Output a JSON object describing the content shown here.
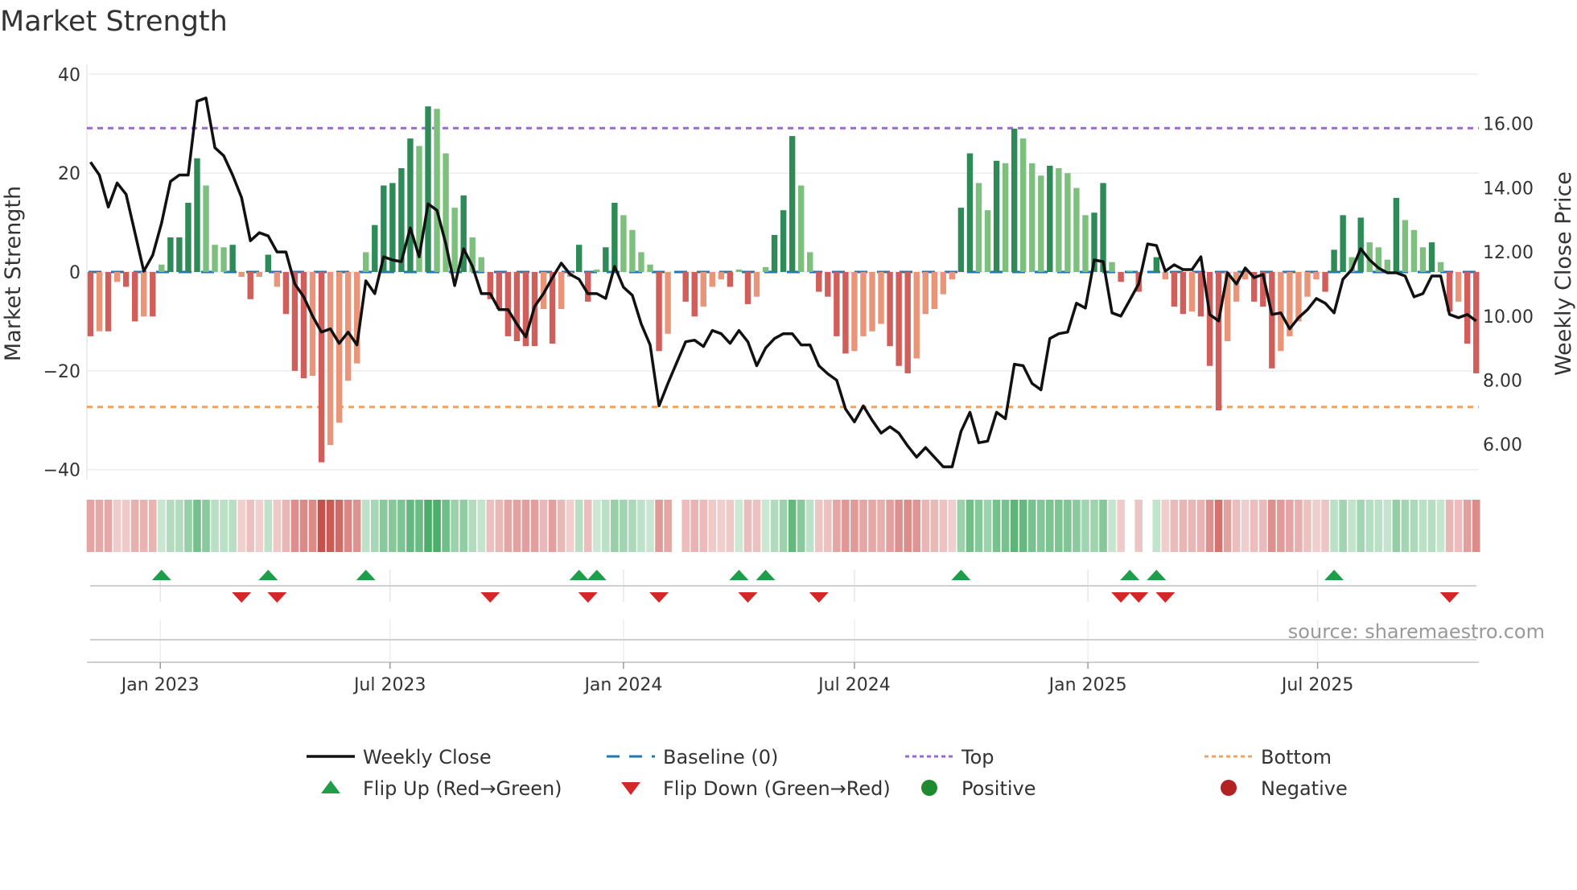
{
  "title": "Market Strength",
  "source": "source: sharemaestro.com",
  "colors": {
    "bar_pos_dark": "#2e8b57",
    "bar_pos_light": "#7dbf7d",
    "bar_neg_dark": "#d05e5b",
    "bar_neg_light": "#e8957a",
    "close": "#111111",
    "baseline": "#1f77b4",
    "top": "#9b66d6",
    "bottom": "#f0a35e",
    "flip_up": "#1f9e4a",
    "flip_down": "#d62728",
    "positive": "#1e8a2e",
    "negative": "#b22222"
  },
  "legend": [
    {
      "label": "Weekly Close",
      "kind": "line",
      "color": "#111111"
    },
    {
      "label": "Baseline (0)",
      "kind": "dash",
      "color": "#1f77b4"
    },
    {
      "label": "Top",
      "kind": "dot",
      "color": "#9b66d6"
    },
    {
      "label": "Bottom",
      "kind": "dot",
      "color": "#f0a35e"
    },
    {
      "label": "Flip Up (Red→Green)",
      "kind": "up",
      "color": "#1f9e4a"
    },
    {
      "label": "Flip Down (Green→Red)",
      "kind": "down",
      "color": "#d62728"
    },
    {
      "label": "Positive",
      "kind": "circle",
      "color": "#1e8a2e"
    },
    {
      "label": "Negative",
      "kind": "circle",
      "color": "#b22222"
    }
  ],
  "chart_data": {
    "type": "bar",
    "title": "Market Strength",
    "ylabel": "Market Strength",
    "y2label": "Weekly Close Price",
    "ylim": [
      -42,
      42
    ],
    "y2lim": [
      4.9,
      17.85
    ],
    "yticks": [
      {
        "v": 40,
        "label": "40"
      },
      {
        "v": 20,
        "label": "20"
      },
      {
        "v": 0,
        "label": "0"
      },
      {
        "v": -20,
        "label": "−20"
      },
      {
        "v": -40,
        "label": "−40"
      }
    ],
    "y2ticks": [
      {
        "v": 16,
        "label": "16.00"
      },
      {
        "v": 14,
        "label": "14.00"
      },
      {
        "v": 12,
        "label": "12.00"
      },
      {
        "v": 10,
        "label": "10.00"
      },
      {
        "v": 8,
        "label": "8.00"
      },
      {
        "v": 6,
        "label": "6.00"
      }
    ],
    "xticks": [
      {
        "date": "2023-01-01",
        "label": "Jan 2023"
      },
      {
        "date": "2023-07-01",
        "label": "Jul 2023"
      },
      {
        "date": "2024-01-01",
        "label": "Jan 2024"
      },
      {
        "date": "2024-07-01",
        "label": "Jul 2024"
      },
      {
        "date": "2025-01-01",
        "label": "Jan 2025"
      },
      {
        "date": "2025-07-01",
        "label": "Jul 2025"
      }
    ],
    "x_start": "2022-11-07",
    "x_step_days": 7,
    "top_level": 29.1,
    "bottom_level": -27.3,
    "strength": [
      -13,
      -12,
      -12,
      -2,
      -3,
      -10,
      -9,
      -9,
      1.5,
      7,
      7,
      14,
      23,
      17.5,
      5.5,
      5,
      5.5,
      -1,
      -5.5,
      -1,
      3.5,
      -3,
      -8.5,
      -20,
      -21.5,
      -21,
      -38.5,
      -35,
      -30.5,
      -22,
      -18.5,
      4,
      9.5,
      17.5,
      18,
      21,
      27,
      25.5,
      33.5,
      33,
      24,
      13,
      15.5,
      7,
      3,
      -5.5,
      -7.5,
      -13,
      -14,
      -15,
      -15,
      -7.5,
      -14.5,
      -7.5,
      -1,
      5.5,
      -6,
      0.5,
      5,
      14,
      11.5,
      8.5,
      4,
      1.5,
      -16,
      -12.5,
      0,
      -6,
      -9,
      -7,
      -3,
      -1.5,
      -3,
      0.5,
      -6.5,
      -5,
      1,
      7.5,
      12.5,
      27.5,
      17.5,
      4,
      -4,
      -5,
      -13,
      -16.5,
      -16,
      -13,
      -12,
      -10.5,
      -15,
      -19,
      -20.5,
      -17.5,
      -8.5,
      -7.5,
      -4.5,
      -1.5,
      13,
      24,
      18,
      12.5,
      22.5,
      22,
      29,
      27,
      22,
      19.5,
      21.5,
      21,
      20,
      17,
      11.5,
      12,
      18,
      2,
      -2,
      0.3,
      -4,
      0,
      3,
      -1.5,
      -7,
      -8.5,
      -8,
      -9,
      -19,
      -28,
      -14,
      -6,
      -1.5,
      -6,
      -7,
      -19.5,
      -16,
      -13,
      -10,
      -5,
      -1.5,
      -4,
      4.5,
      11.5,
      3,
      11,
      6,
      5,
      2.5,
      15,
      10.5,
      8.5,
      5,
      6,
      2,
      -8,
      -6,
      -14.5,
      -20.5
    ],
    "weekly_close": [
      14.8,
      14.4,
      13.4,
      14.15,
      13.8,
      12.6,
      11.4,
      11.9,
      12.9,
      14.2,
      14.4,
      14.4,
      16.7,
      16.8,
      15.25,
      15.0,
      14.4,
      13.7,
      12.35,
      12.6,
      12.5,
      12.0,
      12.0,
      11.0,
      10.6,
      10.0,
      9.5,
      9.6,
      9.15,
      9.5,
      9.1,
      11.1,
      10.7,
      11.85,
      11.75,
      11.7,
      12.75,
      11.85,
      13.5,
      13.3,
      12.25,
      10.95,
      12.1,
      11.55,
      10.7,
      10.7,
      10.2,
      10.2,
      9.75,
      9.35,
      10.3,
      10.7,
      11.2,
      11.65,
      11.3,
      11.15,
      10.7,
      10.7,
      10.55,
      11.55,
      10.9,
      10.65,
      9.75,
      9.1,
      7.2,
      7.9,
      8.55,
      9.2,
      9.25,
      9.05,
      9.55,
      9.45,
      9.15,
      9.55,
      9.2,
      8.45,
      9.0,
      9.3,
      9.45,
      9.45,
      9.1,
      9.1,
      8.45,
      8.2,
      8.0,
      7.1,
      6.7,
      7.2,
      6.75,
      6.35,
      6.55,
      6.35,
      5.95,
      5.6,
      5.9,
      5.6,
      5.3,
      5.3,
      6.4,
      7.0,
      6.05,
      6.1,
      7.0,
      6.8,
      8.5,
      8.45,
      7.9,
      7.7,
      9.3,
      9.45,
      9.5,
      10.4,
      10.25,
      11.75,
      11.7,
      10.1,
      10.0,
      10.5,
      11.0,
      12.25,
      12.2,
      11.4,
      11.6,
      11.45,
      11.45,
      11.85,
      10.05,
      9.85,
      11.35,
      11.0,
      11.5,
      11.2,
      11.3,
      10.05,
      10.1,
      9.6,
      9.95,
      10.2,
      10.55,
      10.4,
      10.1,
      11.15,
      11.45,
      12.1,
      11.75,
      11.5,
      11.35,
      11.35,
      11.25,
      10.6,
      10.7,
      11.25,
      11.25,
      10.05,
      9.95,
      10.05,
      9.85
    ],
    "flip_up_weeks": [
      8,
      20,
      31,
      55,
      57,
      73,
      76,
      98,
      117,
      120,
      140
    ],
    "flip_down_weeks": [
      17,
      21,
      45,
      56,
      64,
      74,
      82,
      116,
      118,
      121,
      153
    ]
  }
}
